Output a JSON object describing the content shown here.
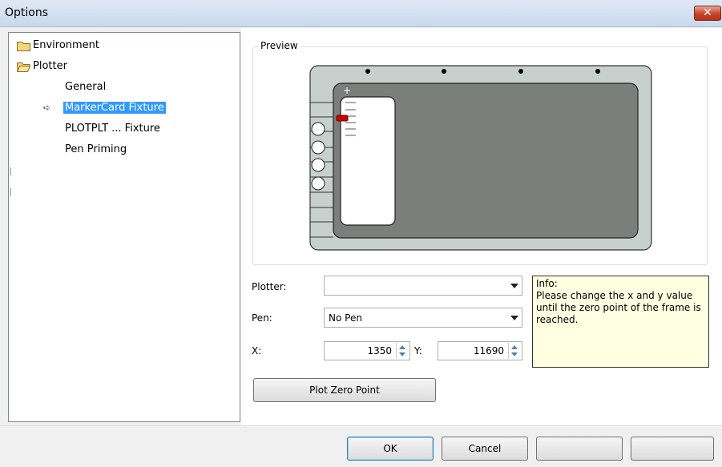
{
  "window": {
    "title": "Options",
    "close_label": "✕"
  },
  "tree": {
    "items": [
      {
        "label": "Environment",
        "icon": "folder-closed-icon"
      },
      {
        "label": "Plotter",
        "icon": "folder-open-icon"
      },
      {
        "label": "General"
      },
      {
        "label": "MarkerCard Fixture",
        "selected": true
      },
      {
        "label": "PLOTPLT ... Fixture"
      },
      {
        "label": "Pen Priming"
      }
    ]
  },
  "preview": {
    "group_label": "Preview"
  },
  "form": {
    "plotter": {
      "label": "Plotter:",
      "value": ""
    },
    "pen": {
      "label": "Pen:",
      "value": "No Pen"
    },
    "x": {
      "label": "X:",
      "value": "1350"
    },
    "y": {
      "label": "Y:",
      "value": "11690"
    },
    "plot_zero_point_label": "Plot Zero Point"
  },
  "info": {
    "title": "Info:",
    "text": "Please change the x and y value until the zero point of the frame is reached."
  },
  "footer": {
    "ok_label": "OK",
    "cancel_label": "Cancel",
    "button3_label": "",
    "button4_label": ""
  },
  "colors": {
    "selection": "#3399ff",
    "plotter_bed": "#7a7f7c",
    "info_bg": "#ffffe1",
    "marker": "#cc0000"
  }
}
